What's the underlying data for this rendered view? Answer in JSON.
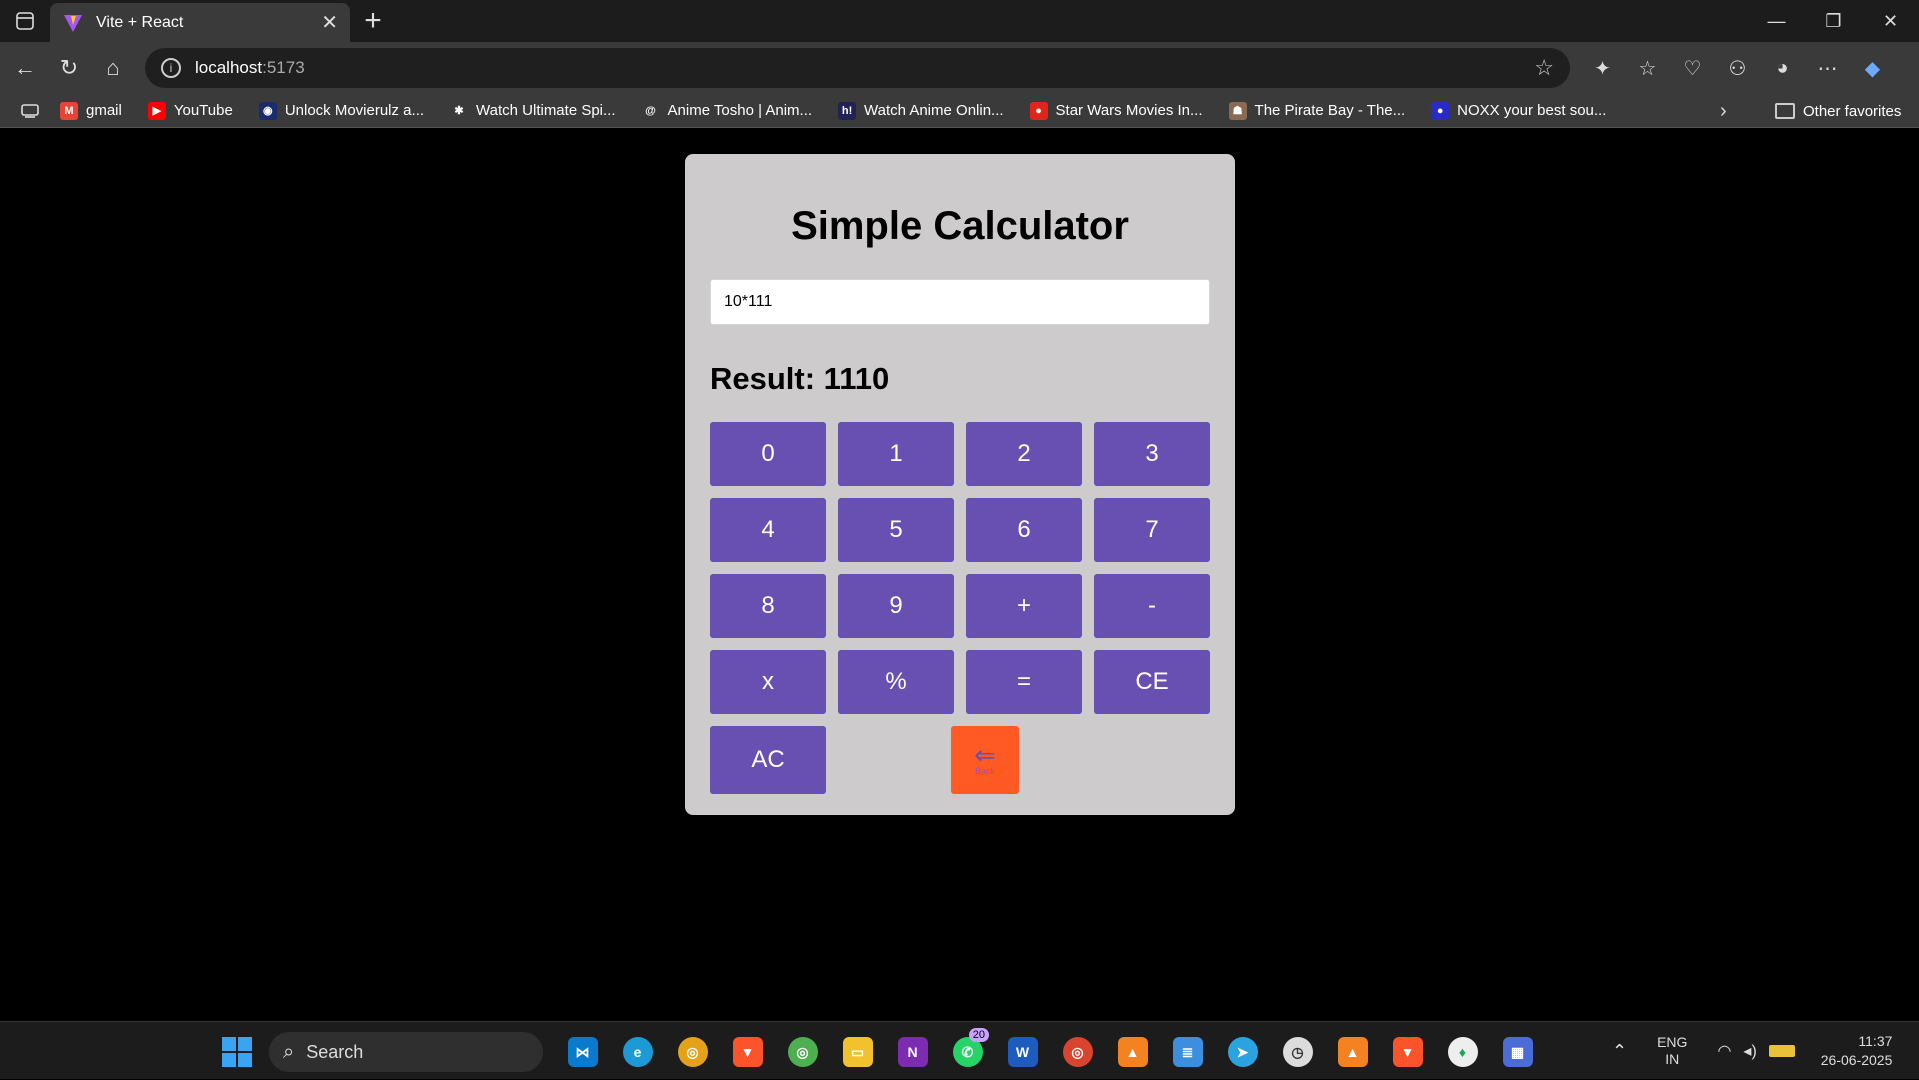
{
  "tab": {
    "title": "Vite + React",
    "close": "✕"
  },
  "address": {
    "host": "localhost",
    "port": ":5173"
  },
  "bookmarks": [
    {
      "label": "gmail",
      "icon": "gmail-icon",
      "color": "#ea4335",
      "glyph": "M"
    },
    {
      "label": "YouTube",
      "icon": "youtube-icon",
      "color": "#ff0000",
      "glyph": "▶"
    },
    {
      "label": "Unlock Movierulz a...",
      "icon": "movierulz-icon",
      "color": "#1a2b6e",
      "glyph": "◉"
    },
    {
      "label": "Watch Ultimate Spi...",
      "icon": "spider-icon",
      "color": "#3a3a3a",
      "glyph": "✱"
    },
    {
      "label": "Anime Tosho | Anim...",
      "icon": "at-icon",
      "color": "#3a3a3a",
      "glyph": "@"
    },
    {
      "label": "Watch Anime Onlin...",
      "icon": "hianime-icon",
      "color": "#222255",
      "glyph": "h!"
    },
    {
      "label": "Star Wars Movies In...",
      "icon": "tomato-icon",
      "color": "#e0261a",
      "glyph": "●"
    },
    {
      "label": "The Pirate Bay - The...",
      "icon": "pirate-icon",
      "color": "#8a6a50",
      "glyph": "☗"
    },
    {
      "label": "NOXX your best sou...",
      "icon": "noxx-icon",
      "color": "#2a2ac8",
      "glyph": "●"
    }
  ],
  "other_favorites": "Other favorites",
  "calculator": {
    "title": "Simple Calculator",
    "input_value": "10*111",
    "result_label": "Result: 1110",
    "buttons": [
      "0",
      "1",
      "2",
      "3",
      "4",
      "5",
      "6",
      "7",
      "8",
      "9",
      "+",
      "-",
      "x",
      "%",
      "=",
      "CE"
    ],
    "ac_label": "AC",
    "back_label": "Back",
    "back_arrow": "⇐",
    "accent": "#6750b2",
    "back_color": "#ff5a24"
  },
  "taskbar": {
    "search_placeholder": "Search",
    "whatsapp_badge": "20",
    "lang_line1": "ENG",
    "lang_line2": "IN",
    "time": "11:37",
    "date": "26-06-2025"
  }
}
